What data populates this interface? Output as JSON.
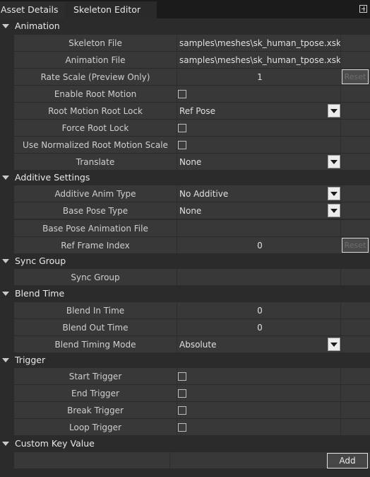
{
  "tabs": {
    "asset_details": "Asset Details",
    "skeleton_editor": "Skeleton Editor"
  },
  "sections": {
    "animation": "Animation",
    "additive": "Additive Settings",
    "sync": "Sync Group",
    "blend": "Blend Time",
    "trigger": "Trigger",
    "custom": "Custom Key Value"
  },
  "animation": {
    "skeleton_file": {
      "label": "Skeleton File",
      "value": "samples\\meshes\\sk_human_tpose.xskt"
    },
    "animation_file": {
      "label": "Animation File",
      "value": "samples\\meshes\\sk_human_tpose.xskt"
    },
    "rate_scale": {
      "label": "Rate Scale (Preview Only)",
      "value": "1",
      "reset": "Reset"
    },
    "enable_root_motion": {
      "label": "Enable Root Motion"
    },
    "root_motion_root_lock": {
      "label": "Root Motion Root Lock",
      "value": "Ref Pose"
    },
    "force_root_lock": {
      "label": "Force Root Lock"
    },
    "use_normalized": {
      "label": "Use Normalized Root Motion Scale"
    },
    "translate": {
      "label": "Translate",
      "value": "None"
    }
  },
  "additive": {
    "anim_type": {
      "label": "Additive Anim Type",
      "value": "No Additive"
    },
    "base_pose_type": {
      "label": "Base Pose Type",
      "value": "None"
    },
    "base_pose_file": {
      "label": "Base Pose Animation File",
      "value": ""
    },
    "ref_frame_index": {
      "label": "Ref Frame Index",
      "value": "0",
      "reset": "Reset"
    }
  },
  "sync": {
    "sync_group": {
      "label": "Sync Group",
      "value": ""
    }
  },
  "blend": {
    "blend_in": {
      "label": "Blend In Time",
      "value": "0"
    },
    "blend_out": {
      "label": "Blend Out Time",
      "value": "0"
    },
    "timing_mode": {
      "label": "Blend Timing Mode",
      "value": "Absolute"
    }
  },
  "trigger": {
    "start": {
      "label": "Start Trigger"
    },
    "end": {
      "label": "End Trigger"
    },
    "break": {
      "label": "Break Trigger"
    },
    "loop": {
      "label": "Loop Trigger"
    }
  },
  "custom": {
    "add": "Add"
  },
  "icons": {
    "pin": "pin-icon",
    "section_arrow": "chevron-down-icon",
    "dropdown_arrow": "chevron-down-icon"
  }
}
